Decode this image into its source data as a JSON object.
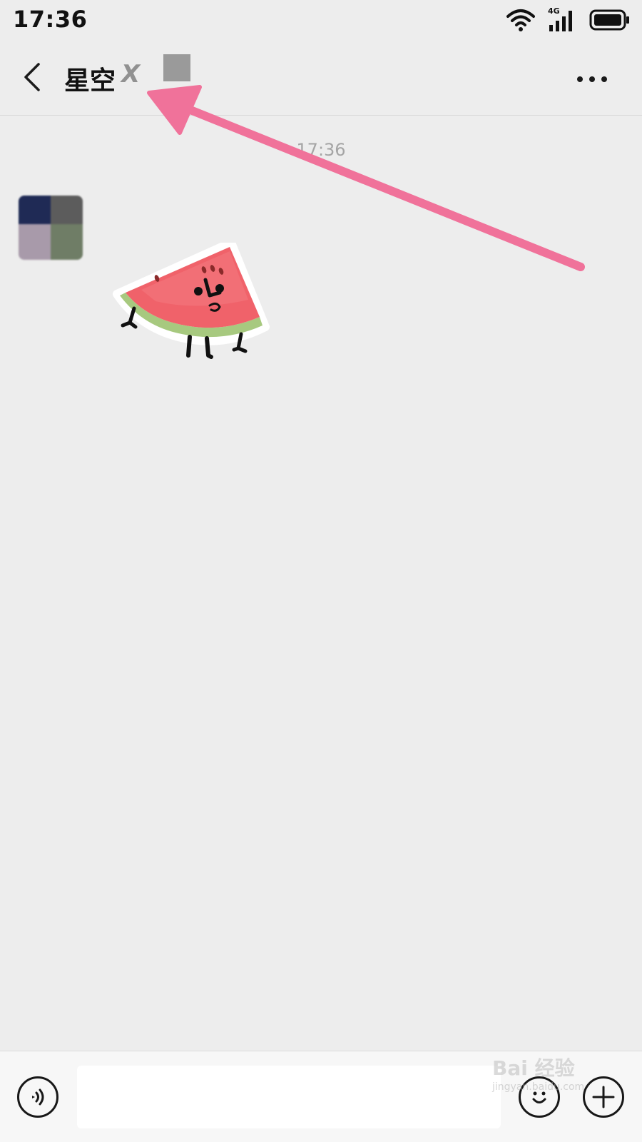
{
  "status_bar": {
    "time": "17:36",
    "network_type": "4G",
    "icons": [
      "wifi-icon",
      "signal-icon",
      "battery-icon"
    ]
  },
  "header": {
    "back_icon": "chevron-left-icon",
    "title": "星空",
    "title_obscured_char": "X",
    "more_icon": "more-horizontal-icon"
  },
  "conversation": {
    "timestamp": "17:36",
    "messages": [
      {
        "sender": "contact",
        "type": "sticker",
        "sticker": "watermelon-sticker"
      }
    ]
  },
  "input_bar": {
    "voice_icon": "voice-icon",
    "text_value": "",
    "emoji_icon": "emoji-icon",
    "plus_icon": "plus-icon"
  },
  "annotation": {
    "arrow_color": "#f0729a"
  },
  "watermark": {
    "main": "Bai 经验",
    "sub": "jingyan.baidu.com"
  },
  "colors": {
    "background": "#ededed",
    "input_bar_background": "#f7f7f7"
  }
}
